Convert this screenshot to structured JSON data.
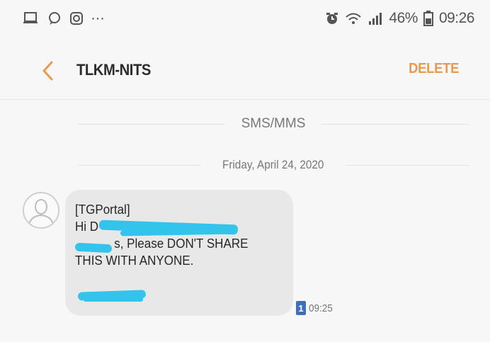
{
  "status_bar": {
    "battery_percent": "46%",
    "time": "09:26",
    "notification_more": "···"
  },
  "app_bar": {
    "title": "TLKM-NITS",
    "delete_label": "DELETE"
  },
  "thread": {
    "channel_label": "SMS/MMS",
    "date_label": "Friday, April 24, 2020"
  },
  "message": {
    "lines": [
      "[TGPortal]",
      "Hi D",
      "s, Please DON'T SHARE",
      "THIS WITH ANYONE."
    ],
    "sim_slot": "1",
    "time": "09:25"
  },
  "colors": {
    "accent": "#e89a4e",
    "bubble": "#e8e8e8",
    "redaction": "#33c4ec",
    "sim_badge": "#3f6fb5"
  }
}
